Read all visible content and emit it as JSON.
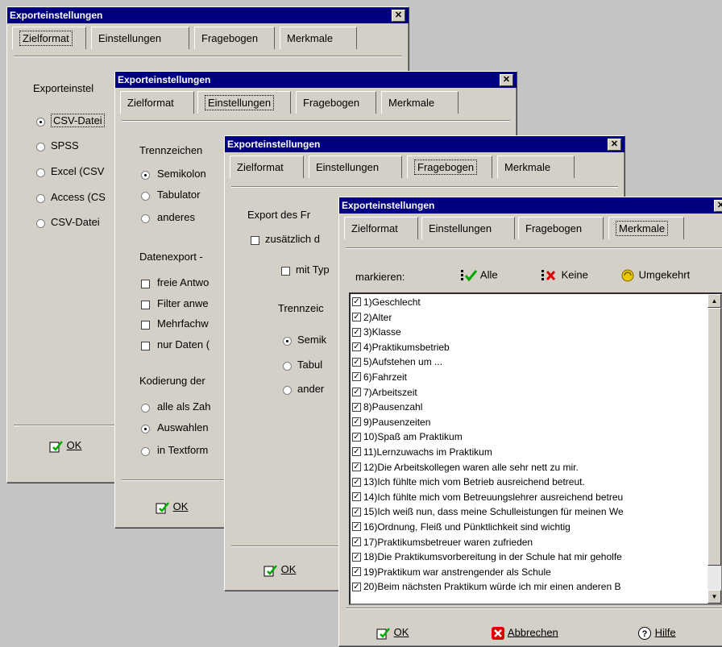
{
  "window_title": "Exporteinstellungen",
  "close_glyph": "✕",
  "tabs": [
    "Zielformat",
    "Einstellungen",
    "Fragebogen",
    "Merkmale"
  ],
  "ok_label": "OK",
  "win1": {
    "group": "Exporteinstel",
    "options": [
      "CSV-Datei",
      "SPSS",
      "Excel (CSV",
      "Access (CS",
      "CSV-Datei"
    ]
  },
  "win2": {
    "group_sep": "Trennzeichen",
    "sep_options": [
      "Semikolon",
      "Tabulator",
      "anderes"
    ],
    "group_export": "Datenexport -",
    "export_checks": [
      "freie Antwo",
      "Filter anwe",
      "Mehrfachw",
      "nur Daten ("
    ],
    "group_code": "Kodierung der",
    "code_options": [
      "alle als Zah",
      "Auswahlen",
      "in Textform"
    ]
  },
  "win3": {
    "group": "Export des Fr",
    "check1": "zusätzlich d",
    "check2": "mit Typ",
    "sep_group": "Trennzeic",
    "sep_options": [
      "Semik",
      "Tabul",
      "ander"
    ]
  },
  "win4": {
    "mark_label": "markieren:",
    "all_label": "Alle",
    "none_label": "Keine",
    "invert_label": "Umgekehrt",
    "cancel_label": "Abbrechen",
    "help_label": "Hilfe",
    "items": [
      "1)Geschlecht",
      "2)Alter",
      "3)Klasse",
      "4)Praktikumsbetrieb",
      "5)Aufstehen um ...",
      "6)Fahrzeit",
      "7)Arbeitszeit",
      "8)Pausenzahl",
      "9)Pausenzeiten",
      "10)Spaß am Praktikum",
      "11)Lernzuwachs im Praktikum",
      "12)Die Arbeitskollegen waren alle sehr nett zu mir.",
      "13)Ich fühlte mich vom Betrieb ausreichend betreut.",
      "14)Ich fühlte mich vom Betreuungslehrer ausreichend betreu",
      "15)Ich weiß nun, dass meine Schulleistungen für meinen We",
      "16)Ordnung, Fleiß und Pünktlichkeit sind wichtig",
      "17)Praktikumsbetreuer waren zufrieden",
      "18)Die Praktikumsvorbereitung in der Schule hat mir geholfe",
      "19)Praktikum war anstrengender als Schule",
      "20)Beim nächsten Praktikum würde ich mir einen anderen B"
    ]
  }
}
